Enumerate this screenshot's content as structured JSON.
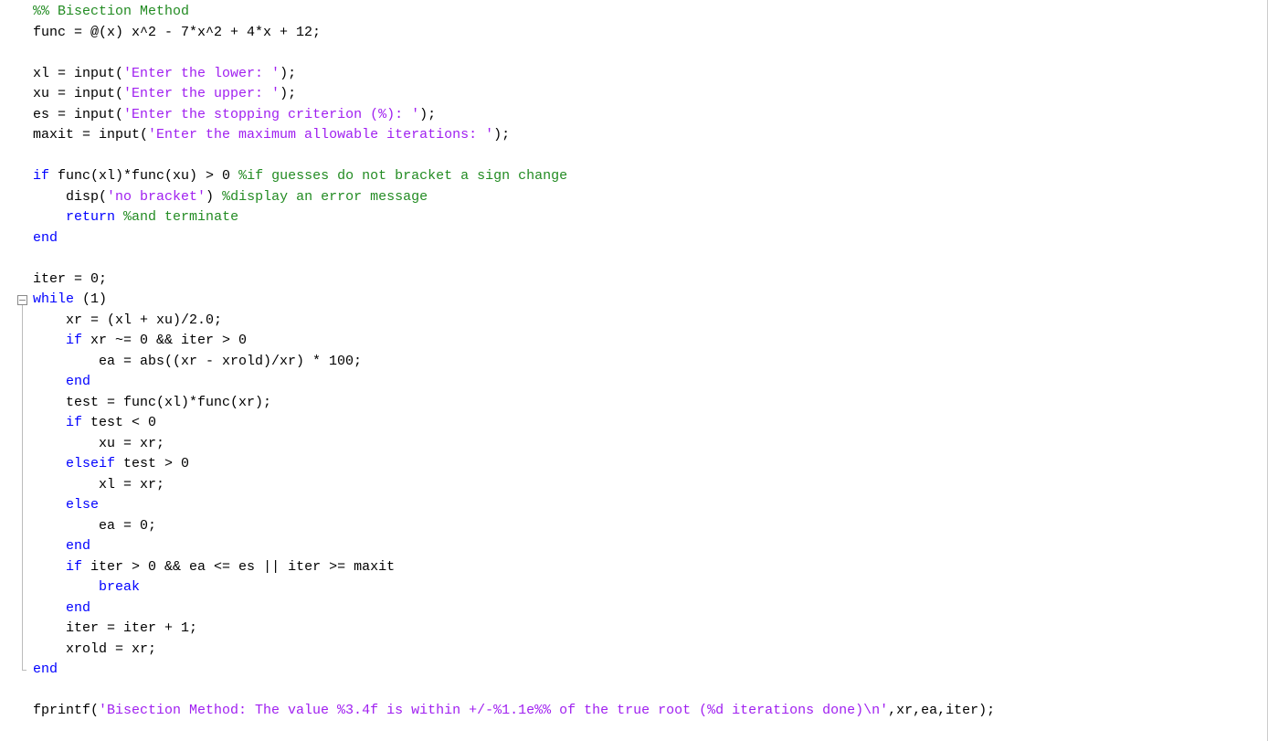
{
  "lineHeight": 22.5,
  "paddingTop": 2,
  "foldStartLine": 14,
  "foldEndLine": 32,
  "lines": [
    [
      {
        "cls": "tok-comment",
        "t": "%% Bisection Method"
      }
    ],
    [
      {
        "cls": "tok-text",
        "t": "func = @(x) x^2 - 7*x^2 + 4*x + 12;"
      }
    ],
    [
      {
        "cls": "tok-text",
        "t": " "
      }
    ],
    [
      {
        "cls": "tok-text",
        "t": "xl = input("
      },
      {
        "cls": "tok-string",
        "t": "'Enter the lower: '"
      },
      {
        "cls": "tok-text",
        "t": ");"
      }
    ],
    [
      {
        "cls": "tok-text",
        "t": "xu = input("
      },
      {
        "cls": "tok-string",
        "t": "'Enter the upper: '"
      },
      {
        "cls": "tok-text",
        "t": ");"
      }
    ],
    [
      {
        "cls": "tok-text",
        "t": "es = input("
      },
      {
        "cls": "tok-string",
        "t": "'Enter the stopping criterion (%): '"
      },
      {
        "cls": "tok-text",
        "t": ");"
      }
    ],
    [
      {
        "cls": "tok-text",
        "t": "maxit = input("
      },
      {
        "cls": "tok-string",
        "t": "'Enter the maximum allowable iterations: '"
      },
      {
        "cls": "tok-text",
        "t": ");"
      }
    ],
    [
      {
        "cls": "tok-text",
        "t": " "
      }
    ],
    [
      {
        "cls": "tok-keyword",
        "t": "if"
      },
      {
        "cls": "tok-text",
        "t": " func(xl)*func(xu) > 0 "
      },
      {
        "cls": "tok-comment",
        "t": "%if guesses do not bracket a sign change"
      }
    ],
    [
      {
        "cls": "tok-text",
        "t": "    disp("
      },
      {
        "cls": "tok-string",
        "t": "'no bracket'"
      },
      {
        "cls": "tok-text",
        "t": ") "
      },
      {
        "cls": "tok-comment",
        "t": "%display an error message"
      }
    ],
    [
      {
        "cls": "tok-text",
        "t": "    "
      },
      {
        "cls": "tok-keyword",
        "t": "return"
      },
      {
        "cls": "tok-text",
        "t": " "
      },
      {
        "cls": "tok-comment",
        "t": "%and terminate"
      }
    ],
    [
      {
        "cls": "tok-keyword",
        "t": "end"
      }
    ],
    [
      {
        "cls": "tok-text",
        "t": " "
      }
    ],
    [
      {
        "cls": "tok-text",
        "t": "iter = 0;"
      }
    ],
    [
      {
        "cls": "tok-keyword",
        "t": "while"
      },
      {
        "cls": "tok-text",
        "t": " (1)"
      }
    ],
    [
      {
        "cls": "tok-text",
        "t": "    xr = (xl + xu)/2.0;"
      }
    ],
    [
      {
        "cls": "tok-text",
        "t": "    "
      },
      {
        "cls": "tok-keyword",
        "t": "if"
      },
      {
        "cls": "tok-text",
        "t": " xr ~= 0 && iter > 0"
      }
    ],
    [
      {
        "cls": "tok-text",
        "t": "        ea = abs((xr - xrold)/xr) * 100;"
      }
    ],
    [
      {
        "cls": "tok-text",
        "t": "    "
      },
      {
        "cls": "tok-keyword",
        "t": "end"
      }
    ],
    [
      {
        "cls": "tok-text",
        "t": "    test = func(xl)*func(xr);"
      }
    ],
    [
      {
        "cls": "tok-text",
        "t": "    "
      },
      {
        "cls": "tok-keyword",
        "t": "if"
      },
      {
        "cls": "tok-text",
        "t": " test < 0"
      }
    ],
    [
      {
        "cls": "tok-text",
        "t": "        xu = xr;"
      }
    ],
    [
      {
        "cls": "tok-text",
        "t": "    "
      },
      {
        "cls": "tok-keyword",
        "t": "elseif"
      },
      {
        "cls": "tok-text",
        "t": " test > 0"
      }
    ],
    [
      {
        "cls": "tok-text",
        "t": "        xl = xr;"
      }
    ],
    [
      {
        "cls": "tok-text",
        "t": "    "
      },
      {
        "cls": "tok-keyword",
        "t": "else"
      }
    ],
    [
      {
        "cls": "tok-text",
        "t": "        ea = 0;"
      }
    ],
    [
      {
        "cls": "tok-text",
        "t": "    "
      },
      {
        "cls": "tok-keyword",
        "t": "end"
      }
    ],
    [
      {
        "cls": "tok-text",
        "t": "    "
      },
      {
        "cls": "tok-keyword",
        "t": "if"
      },
      {
        "cls": "tok-text",
        "t": " iter > 0 && ea <= es || iter >= maxit"
      }
    ],
    [
      {
        "cls": "tok-text",
        "t": "        "
      },
      {
        "cls": "tok-keyword",
        "t": "break"
      }
    ],
    [
      {
        "cls": "tok-text",
        "t": "    "
      },
      {
        "cls": "tok-keyword",
        "t": "end"
      }
    ],
    [
      {
        "cls": "tok-text",
        "t": "    iter = iter + 1;"
      }
    ],
    [
      {
        "cls": "tok-text",
        "t": "    xrold = xr;"
      }
    ],
    [
      {
        "cls": "tok-keyword",
        "t": "end"
      }
    ],
    [
      {
        "cls": "tok-text",
        "t": " "
      }
    ],
    [
      {
        "cls": "tok-text",
        "t": "fprintf("
      },
      {
        "cls": "tok-string",
        "t": "'Bisection Method: The value %3.4f is within +/-%1.1e%% of the true root (%d iterations done)\\n'"
      },
      {
        "cls": "tok-text",
        "t": ",xr,ea,iter);"
      }
    ]
  ]
}
